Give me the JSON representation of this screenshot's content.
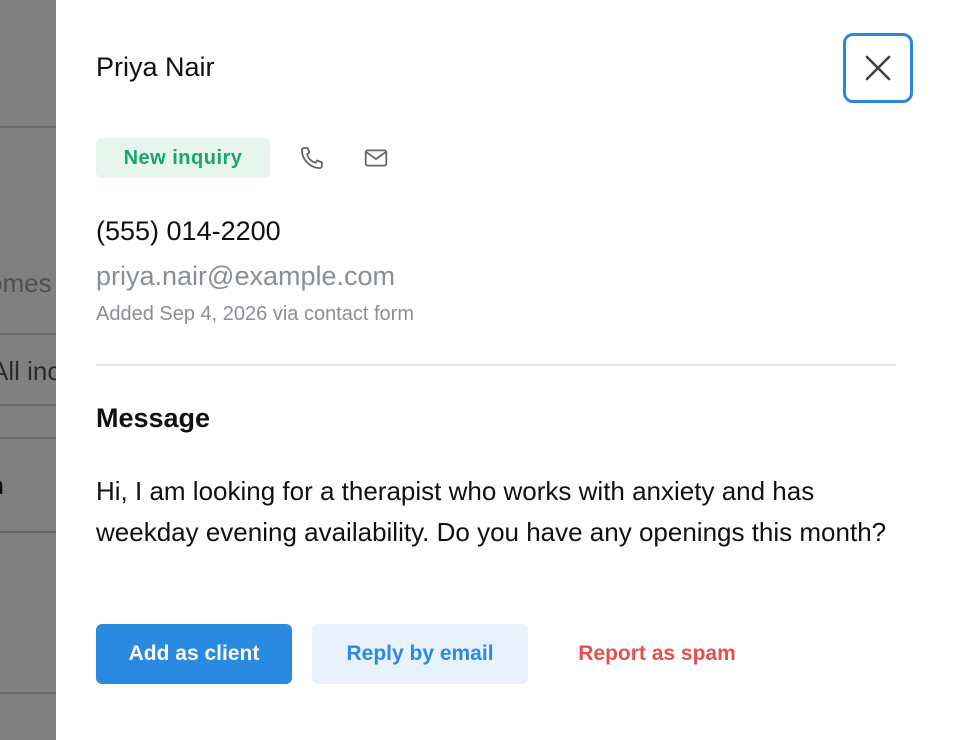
{
  "background": {
    "text_fragments": [
      "omes",
      "All inc",
      "n"
    ]
  },
  "drawer": {
    "name": "Priya Nair",
    "status_badge": "New inquiry",
    "phone": "(555) 014-2200",
    "email": "priya.nair@example.com",
    "added": "Added Sep 4, 2026 via contact form",
    "message_title": "Message",
    "message_body": "Hi, I am looking for a therapist who works with anxiety and has weekday evening availability. Do you have any openings this month?",
    "buttons": {
      "add_client": "Add as client",
      "reply_email": "Reply by email",
      "report_spam": "Report as spam"
    },
    "icons": {
      "close": "close-icon",
      "phone": "phone-icon",
      "mail": "mail-icon"
    }
  },
  "colors": {
    "accent": "#2a89e0",
    "badge_bg": "#e6f6ef",
    "badge_text": "#1aa56a",
    "danger": "#ea4d4d",
    "muted_text": "#8a8f96",
    "overlay": "#808080"
  }
}
